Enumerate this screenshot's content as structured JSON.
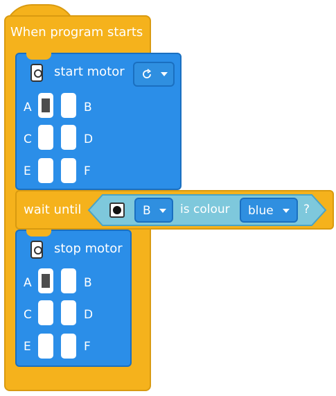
{
  "program": {
    "hat_title": "When program starts"
  },
  "start_motor": {
    "label": "start motor",
    "direction_icon": "clockwise-arrow-icon",
    "ports": {
      "A": "A",
      "B": "B",
      "C": "C",
      "D": "D",
      "E": "E",
      "F": "F"
    },
    "selected_port": "A"
  },
  "wait_block": {
    "label": "wait until",
    "sensor_icon": "color-sensor-icon",
    "port_value": "B",
    "condition_text": "is colour",
    "colour_value": "blue",
    "question": "?"
  },
  "stop_motor": {
    "label": "stop motor",
    "ports": {
      "A": "A",
      "B": "B",
      "C": "C",
      "D": "D",
      "E": "E",
      "F": "F"
    },
    "selected_port": "A"
  },
  "colors": {
    "event_orange": "#f5b21c",
    "motor_blue": "#2b8ee8",
    "sensor_teal": "#7ec8dc"
  }
}
